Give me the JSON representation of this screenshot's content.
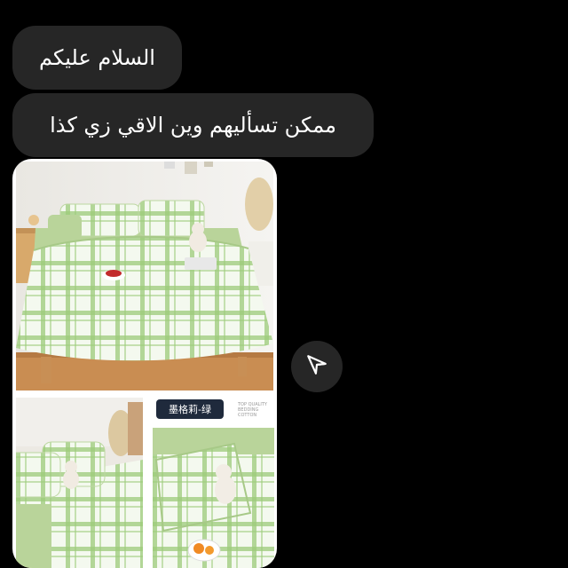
{
  "messages": [
    {
      "text": "السلام عليكم"
    },
    {
      "text": "ممكن تسأليهم وين الاقي زي كذا"
    }
  ],
  "photo": {
    "tag_label": "墨格莉-绿",
    "tag_fine_text": "TOP QUALITY\nBEDDING\nCOTTON"
  },
  "icons": {
    "share": "paper-plane-icon"
  },
  "colors": {
    "background": "#000000",
    "bubble": "#262626",
    "plaid_green": "#86be60",
    "sheet_green": "#b9d49a"
  }
}
